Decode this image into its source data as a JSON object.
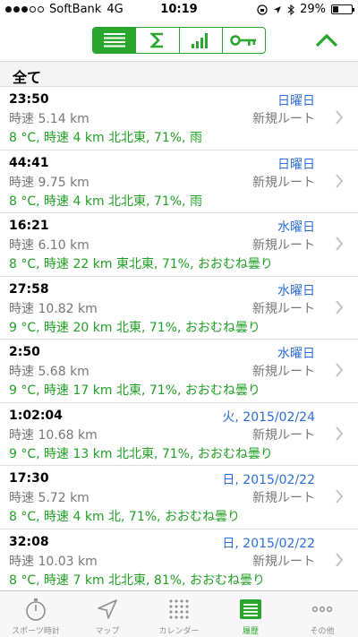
{
  "status_bar": {
    "carrier": "SoftBank",
    "network": "4G",
    "time": "10:19",
    "battery": "29%",
    "battery_level": 0.29
  },
  "section_title": "全て",
  "workouts": [
    {
      "duration": "23:50",
      "date": "日曜日",
      "speed": "時速 5.14 km",
      "route": "新規ルート",
      "weather": "8 °C, 時速 4 km 北北東, 71%, 雨"
    },
    {
      "duration": "44:41",
      "date": "日曜日",
      "speed": "時速 9.75 km",
      "route": "新規ルート",
      "weather": "8 °C, 時速 4 km 北北東, 71%, 雨"
    },
    {
      "duration": "16:21",
      "date": "水曜日",
      "speed": "時速 6.10 km",
      "route": "新規ルート",
      "weather": "8 °C, 時速 22 km 東北東, 71%, おおむね曇り"
    },
    {
      "duration": "27:58",
      "date": "水曜日",
      "speed": "時速 10.82 km",
      "route": "新規ルート",
      "weather": "9 °C, 時速 20 km 北東, 71%, おおむね曇り"
    },
    {
      "duration": "2:50",
      "date": "水曜日",
      "speed": "時速 5.68 km",
      "route": "新規ルート",
      "weather": "9 °C, 時速 17 km 北東, 71%, おおむね曇り"
    },
    {
      "duration": "1:02:04",
      "date": "火, 2015/02/24",
      "speed": "時速 10.68 km",
      "route": "新規ルート",
      "weather": "9 °C, 時速 13 km 北北東, 71%, おおむね曇り"
    },
    {
      "duration": "17:30",
      "date": "日, 2015/02/22",
      "speed": "時速 5.72 km",
      "route": "新規ルート",
      "weather": "8 °C, 時速 4 km 北, 71%, おおむね曇り"
    },
    {
      "duration": "32:08",
      "date": "日, 2015/02/22",
      "speed": "時速 10.03 km",
      "route": "新規ルート",
      "weather": "8 °C, 時速 7 km 北北東, 81%, おおむね曇り"
    }
  ],
  "tabs": [
    {
      "label": "スポーツ時計",
      "icon": "stopwatch-icon"
    },
    {
      "label": "マップ",
      "icon": "location-arrow-icon"
    },
    {
      "label": "カレンダー",
      "icon": "calendar-grid-icon"
    },
    {
      "label": "履歴",
      "icon": "history-list-icon"
    },
    {
      "label": "その他",
      "icon": "more-dots-icon"
    }
  ],
  "colors": {
    "accent": "#2aa52e",
    "date": "#2d6fd8",
    "muted": "#777777"
  }
}
